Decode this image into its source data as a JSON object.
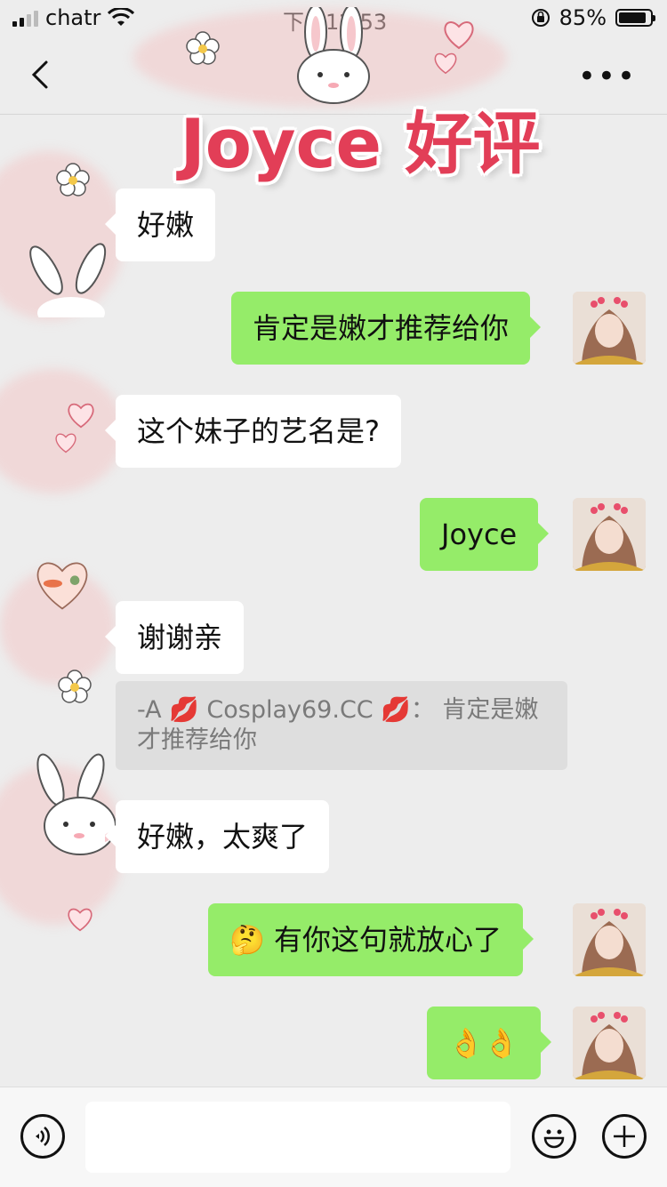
{
  "status_bar": {
    "carrier": "chatr",
    "time": "下午12:53",
    "battery_percent": "85%"
  },
  "sticker": {
    "title": "Joyce 好评"
  },
  "messages": [
    {
      "side": "in",
      "text": "好嫩"
    },
    {
      "side": "out",
      "text": "肯定是嫩才推荐给你"
    },
    {
      "side": "in",
      "text": "这个妹子的艺名是?"
    },
    {
      "side": "out",
      "text": "Joyce"
    },
    {
      "side": "in",
      "text": "谢谢亲"
    },
    {
      "side": "in",
      "text": "好嫩，太爽了"
    },
    {
      "side": "out",
      "text": "有你这句就放心了",
      "emoji": "🤔"
    },
    {
      "side": "out",
      "text": "👌👌"
    }
  ],
  "quote": {
    "text": "-A 💋 Cosplay69.CC 💋：  肯定是嫩才推荐给你"
  },
  "icons": {
    "back": "chevron-left-icon",
    "more": "more-dots-icon",
    "voice": "voice-icon",
    "emoji": "emoji-icon",
    "plus": "plus-icon"
  },
  "colors": {
    "outgoing_bubble": "#95ec69",
    "incoming_bubble": "#ffffff",
    "background": "#ededed",
    "sticker_text": "#e23e57"
  }
}
